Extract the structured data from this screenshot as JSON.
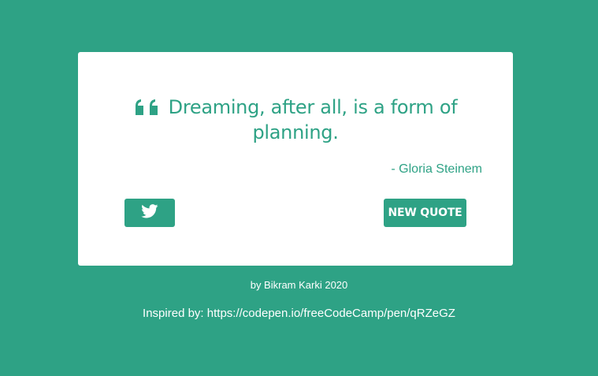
{
  "quote": {
    "text": "Dreaming, after all, is a form of planning.",
    "author": "- Gloria Steinem",
    "icon": "quote-left-icon"
  },
  "actions": {
    "tweet_icon": "twitter-icon",
    "new_quote_label": "NEW QUOTE"
  },
  "footer": {
    "credit": "by Bikram Karki 2020",
    "inspired_label": "Inspired by: ",
    "inspired_url": "https://codepen.io/freeCodeCamp/pen/qRZeGZ"
  },
  "colors": {
    "accent": "#2ea285",
    "card": "#ffffff"
  }
}
